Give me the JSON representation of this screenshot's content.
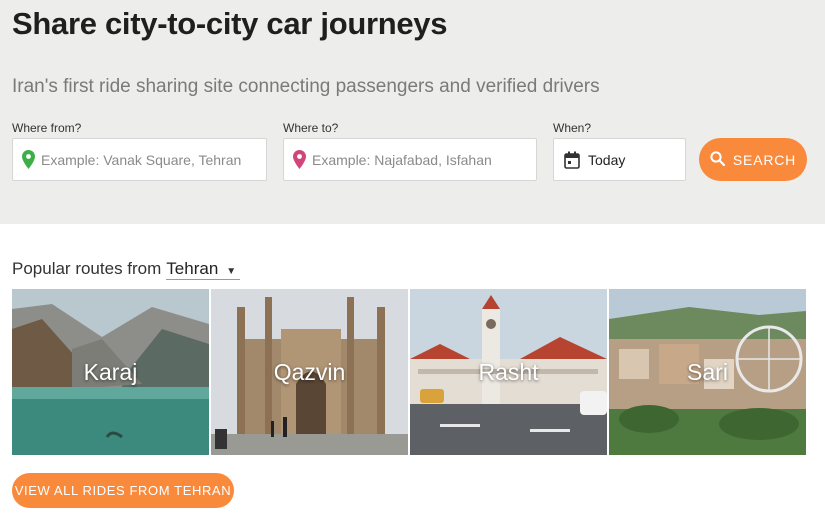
{
  "hero": {
    "title": "Share city-to-city car journeys",
    "subtitle": "Iran's first ride sharing site connecting passengers and verified drivers"
  },
  "search_form": {
    "from": {
      "label": "Where from?",
      "placeholder": "Example: Vanak Square, Tehran",
      "icon": "pin-icon",
      "icon_color": "#3fae49"
    },
    "to": {
      "label": "Where to?",
      "placeholder": "Example: Najafabad, Isfahan",
      "icon": "pin-icon",
      "icon_color": "#d0467a"
    },
    "when": {
      "label": "When?",
      "value": "Today",
      "icon": "calendar-icon"
    },
    "search_button": {
      "label": "SEARCH",
      "icon": "search-icon"
    }
  },
  "popular_routes": {
    "prefix": "Popular routes from",
    "selected_city": "Tehran",
    "routes": [
      {
        "city": "Karaj"
      },
      {
        "city": "Qazvin"
      },
      {
        "city": "Rasht"
      },
      {
        "city": "Sari"
      }
    ]
  },
  "view_all_label": "VIEW ALL RIDES FROM TEHRAN",
  "colors": {
    "accent": "#f98a3b",
    "hero_bg": "#ededeb"
  }
}
